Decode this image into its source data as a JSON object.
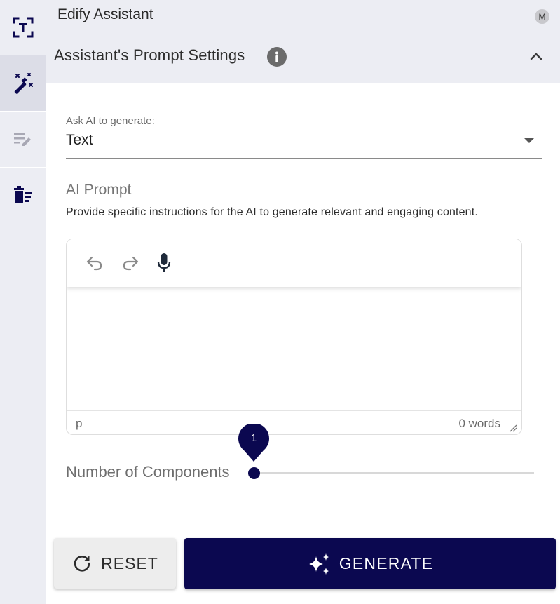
{
  "app": {
    "title": "Edify Assistant",
    "avatar_initial": "M"
  },
  "sidebar": {
    "items": [
      {
        "name": "text-extract",
        "icon": "text-frame-icon",
        "active": false
      },
      {
        "name": "ai-generate",
        "icon": "magic-wand-icon",
        "active": true
      },
      {
        "name": "edit",
        "icon": "edit-list-icon",
        "active": false
      },
      {
        "name": "delete-list",
        "icon": "delete-list-icon",
        "active": false
      }
    ]
  },
  "panel": {
    "title": "Assistant's Prompt Settings"
  },
  "generate_select": {
    "label": "Ask AI to generate:",
    "value": "Text"
  },
  "prompt": {
    "title": "AI Prompt",
    "description": "Provide specific instructions for the AI to generate relevant and engaging content."
  },
  "editor": {
    "status_path": "p",
    "word_count": "0 words",
    "content": ""
  },
  "components_slider": {
    "label": "Number of Components",
    "value": "1"
  },
  "actions": {
    "reset_label": "RESET",
    "generate_label": "GENERATE"
  },
  "colors": {
    "primary": "#0b0850",
    "sidebar_bg": "#ecedf3",
    "active_bg": "#dcdde7"
  }
}
